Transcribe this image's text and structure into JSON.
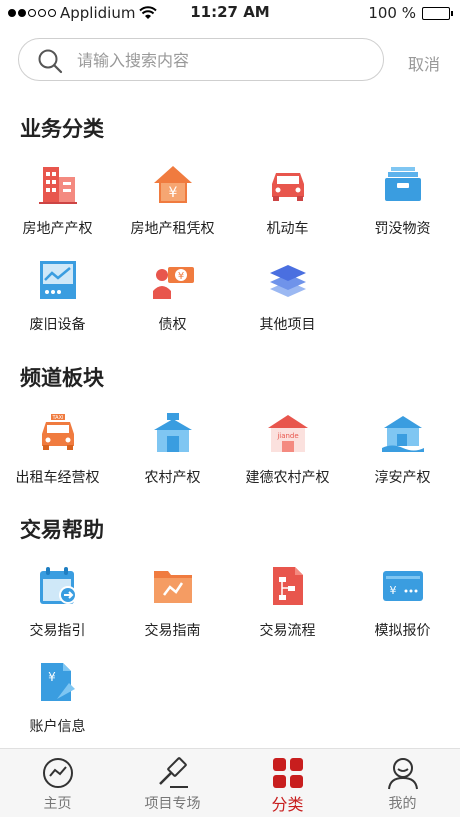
{
  "status": {
    "carrier": "Applidium",
    "time": "11:27 AM",
    "battery": "100 %"
  },
  "search": {
    "placeholder": "请输入搜索内容",
    "cancel": "取消"
  },
  "sections": {
    "business": {
      "title": "业务分类",
      "items": [
        "房地产产权",
        "房地产租凭权",
        "机动车",
        "罚没物资",
        "废旧设备",
        "债权",
        "其他项目"
      ]
    },
    "channel": {
      "title": "频道板块",
      "items": [
        "出租车经营权",
        "农村产权",
        "建德农村产权",
        "淳安产权"
      ]
    },
    "help": {
      "title": "交易帮助",
      "items": [
        "交易指引",
        "交易指南",
        "交易流程",
        "模拟报价",
        "账户信息"
      ]
    }
  },
  "tabs": [
    "主页",
    "项目专场",
    "分类",
    "我的"
  ],
  "active_tab": "分类",
  "colors": {
    "accent": "#c81e1e",
    "orange": "#f07b3f",
    "red": "#e8564d",
    "blue": "#3a9de0"
  }
}
